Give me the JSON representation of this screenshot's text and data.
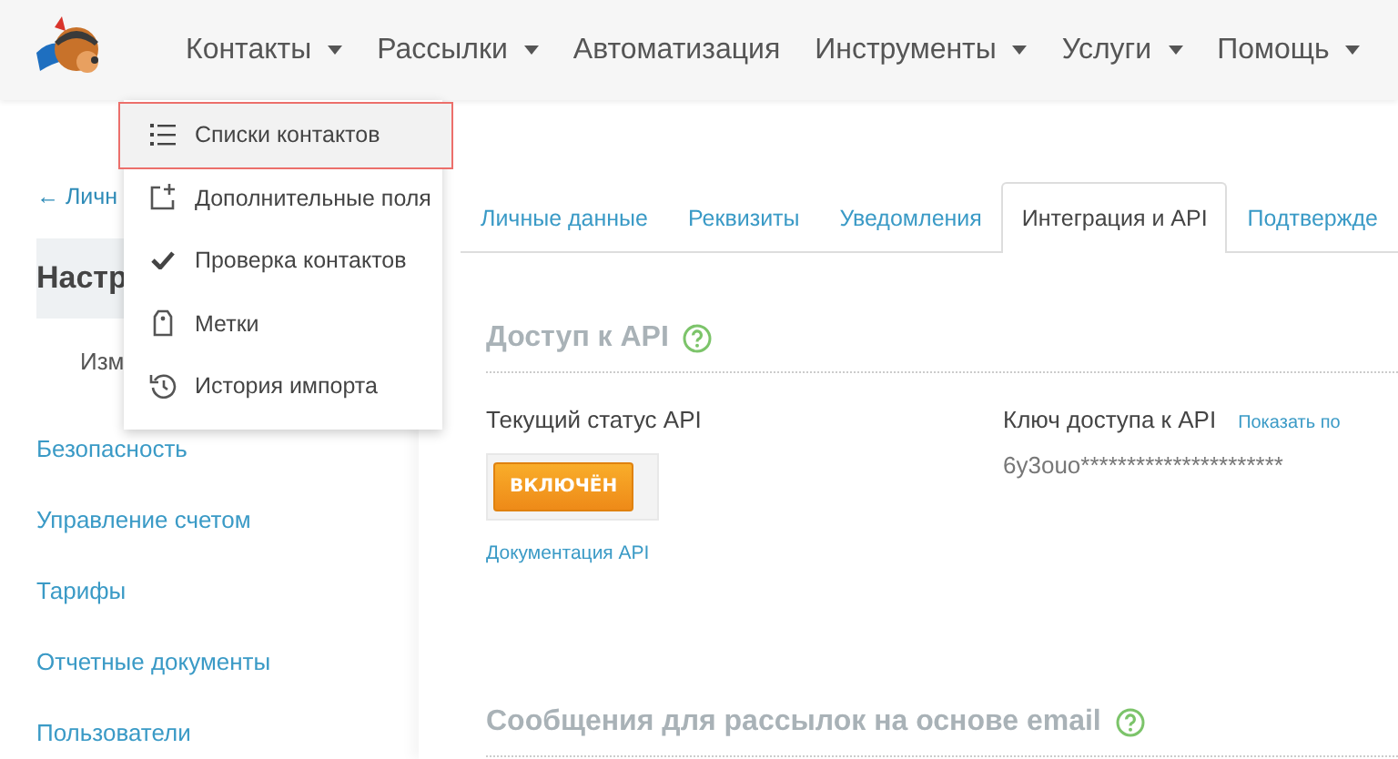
{
  "nav": {
    "items": [
      {
        "label": "Контакты",
        "dropdown": true
      },
      {
        "label": "Рассылки",
        "dropdown": true
      },
      {
        "label": "Автоматизация",
        "dropdown": false
      },
      {
        "label": "Инструменты",
        "dropdown": true
      },
      {
        "label": "Услуги",
        "dropdown": true
      },
      {
        "label": "Помощь",
        "dropdown": true
      }
    ]
  },
  "dropdown_menu": {
    "items": [
      {
        "label": "Списки контактов",
        "kind": "list",
        "selected": true
      },
      {
        "label": "Дополнительные поля",
        "kind": "add-field",
        "selected": false
      },
      {
        "label": "Проверка контактов",
        "kind": "check",
        "selected": false
      },
      {
        "label": "Метки",
        "kind": "tag",
        "selected": false
      },
      {
        "label": "История импорта",
        "kind": "history",
        "selected": false
      }
    ]
  },
  "sidebar": {
    "back_link": "← Личн",
    "section_title": "Настр",
    "subitem": "Изм",
    "links": [
      "Безопасность",
      "Управление счетом",
      "Тарифы",
      "Отчетные документы",
      "Пользователи"
    ]
  },
  "tabs": [
    {
      "label": "Личные данные",
      "selected": false
    },
    {
      "label": "Реквизиты",
      "selected": false
    },
    {
      "label": "Уведомления",
      "selected": false
    },
    {
      "label": "Интеграция и API",
      "selected": true
    },
    {
      "label": "Подтвержде",
      "selected": false
    }
  ],
  "api_section": {
    "title": "Доступ к API",
    "status_label": "Текущий статус API",
    "status_button": "ВКЛЮЧЁН",
    "docs_link": "Документация API",
    "key_label": "Ключ доступа к API",
    "show_link": "Показать по",
    "key_value": "6y3ouo**********************"
  },
  "email_section": {
    "title": "Сообщения для рассылок на основе email"
  }
}
